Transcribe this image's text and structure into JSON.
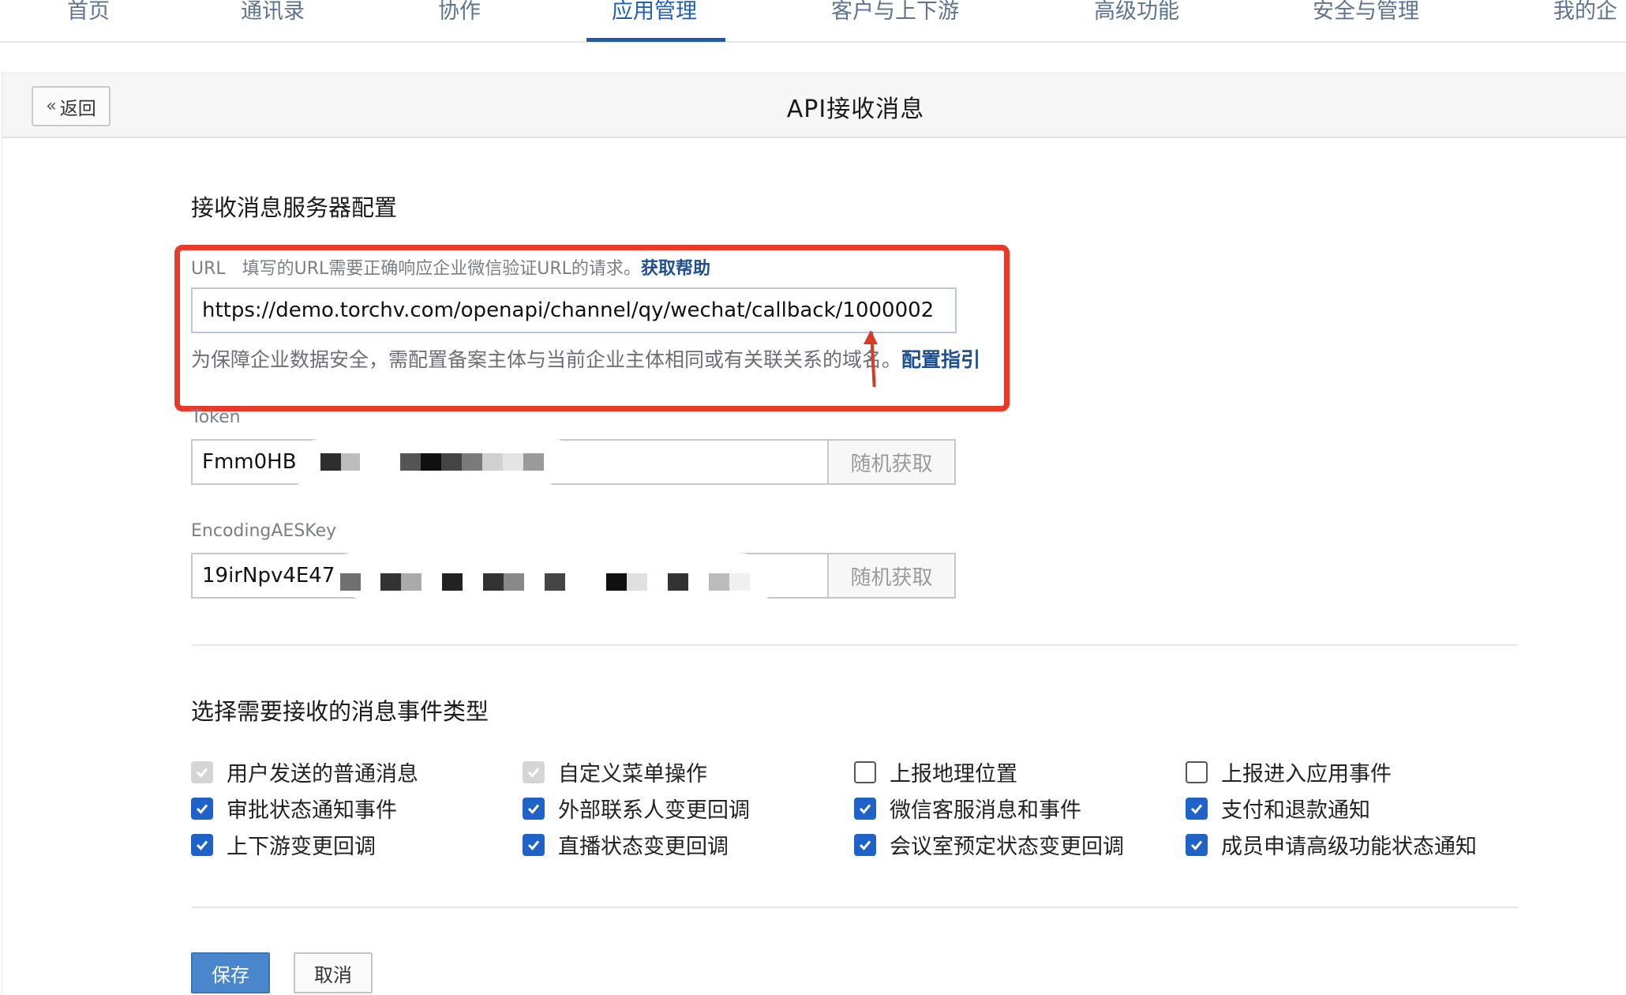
{
  "nav": {
    "items": [
      "首页",
      "通讯录",
      "协作",
      "应用管理",
      "客户与上下游",
      "高级功能",
      "安全与管理",
      "我的企"
    ],
    "active_index": 3
  },
  "header": {
    "back_label": "返回",
    "title": "API接收消息"
  },
  "server_config": {
    "title": "接收消息服务器配置",
    "url": {
      "label": "URL",
      "description": "填写的URL需要正确响应企业微信验证URL的请求。",
      "help_link": "获取帮助",
      "value": "https://demo.torchv.com/openapi/channel/qy/wechat/callback/1000002",
      "hint": "为保障企业数据安全，需配置备案主体与当前企业主体相同或有关联关系的域名。",
      "hint_link": "配置指引"
    },
    "token": {
      "label": "Token",
      "value": "Fmm0HB",
      "button": "随机获取"
    },
    "aes_key": {
      "label": "EncodingAESKey",
      "value": "19irNpv4E47",
      "button": "随机获取"
    }
  },
  "events": {
    "title": "选择需要接收的消息事件类型",
    "items": [
      {
        "label": "用户发送的普通消息",
        "state": "disabled"
      },
      {
        "label": "自定义菜单操作",
        "state": "disabled"
      },
      {
        "label": "上报地理位置",
        "state": "unchecked"
      },
      {
        "label": "上报进入应用事件",
        "state": "unchecked"
      },
      {
        "label": "审批状态通知事件",
        "state": "checked"
      },
      {
        "label": "外部联系人变更回调",
        "state": "checked"
      },
      {
        "label": "微信客服消息和事件",
        "state": "checked"
      },
      {
        "label": "支付和退款通知",
        "state": "checked"
      },
      {
        "label": "上下游变更回调",
        "state": "checked"
      },
      {
        "label": "直播状态变更回调",
        "state": "checked"
      },
      {
        "label": "会议室预定状态变更回调",
        "state": "checked"
      },
      {
        "label": "成员申请高级功能状态通知",
        "state": "checked"
      }
    ]
  },
  "actions": {
    "save": "保存",
    "cancel": "取消"
  },
  "colors": {
    "nav_active": "#1f5fb5",
    "annotation_red": "#e8392a",
    "checkbox_blue": "#1f63c8",
    "save_blue": "#4a86cc"
  }
}
